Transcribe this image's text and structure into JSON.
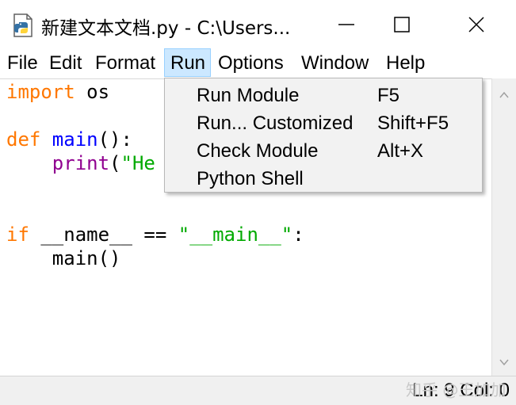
{
  "window": {
    "title": "新建文本文档.py - C:\\Users...",
    "icon": "python-file-icon",
    "buttons": [
      "minimize-icon",
      "maximize-icon",
      "close-icon"
    ]
  },
  "menubar": {
    "items": [
      {
        "label": "File"
      },
      {
        "label": "Edit"
      },
      {
        "label": "Format"
      },
      {
        "label": "Run",
        "active": true
      },
      {
        "label": "Options"
      },
      {
        "label": "Window"
      },
      {
        "label": "Help"
      }
    ]
  },
  "dropdown": {
    "items": [
      {
        "label": "Run Module",
        "accel": "F5"
      },
      {
        "label": "Run... Customized",
        "accel": "Shift+F5"
      },
      {
        "label": "Check Module",
        "accel": "Alt+X"
      },
      {
        "label": "Python Shell",
        "accel": ""
      }
    ]
  },
  "code": {
    "line1": {
      "kw": "import",
      "rest": " os"
    },
    "line3": {
      "kw": "def",
      "fn": " main",
      "rest": "():"
    },
    "line4": {
      "indent": "    ",
      "bi": "print",
      "rest": "(",
      "str": "\"He"
    },
    "line7": {
      "kw": "if",
      "rest": " __name__ == ",
      "str": "\"__main__\"",
      "end": ":"
    },
    "line8": {
      "text": "    main()"
    }
  },
  "status": {
    "text": "Ln: 9  Col: 0"
  },
  "watermark": {
    "text": "知乎 @王加加"
  },
  "colors": {
    "keyword": "#ff7700",
    "builtin": "#900090",
    "definition": "#0000ff",
    "string": "#00aa00",
    "menu_highlight": "#cce8ff"
  }
}
